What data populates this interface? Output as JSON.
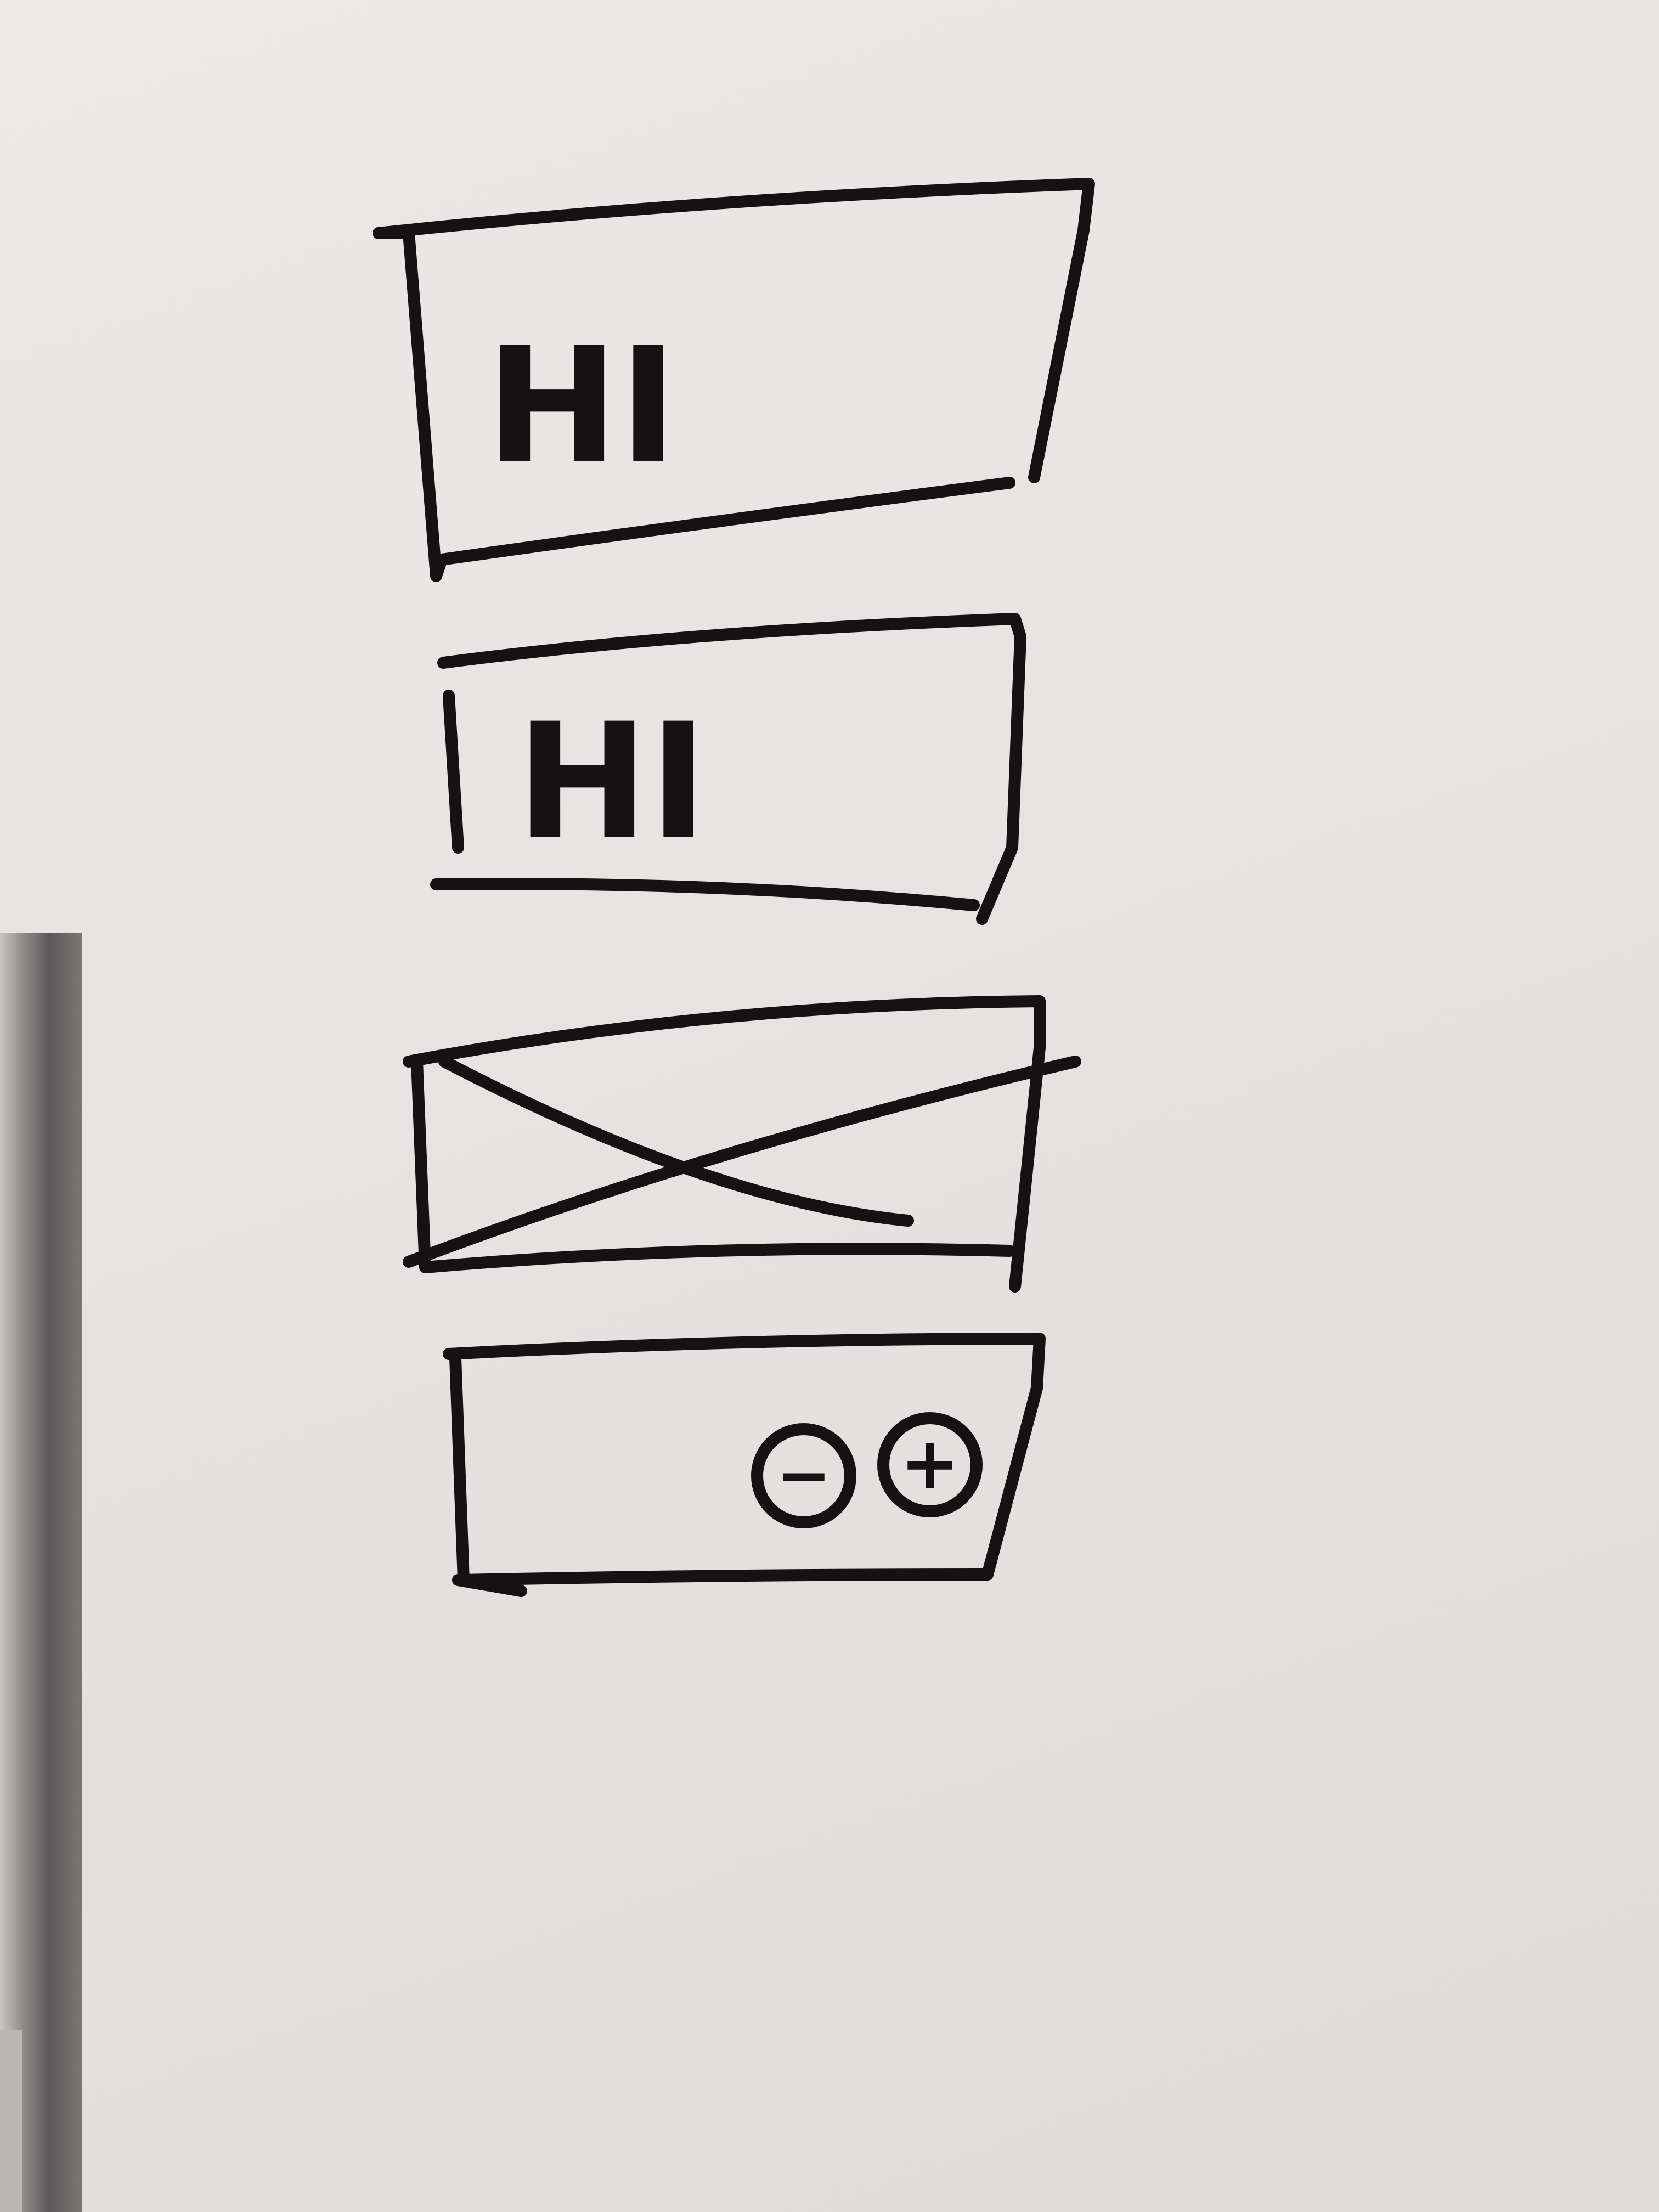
{
  "wireframe": {
    "large_text_box": {
      "text": "HI"
    },
    "text_input": {
      "text": "HI"
    },
    "image_placeholder": {},
    "zoom_card": {
      "zoom_out_symbol": "−",
      "zoom_in_symbol": "+"
    }
  },
  "colors": {
    "marker": "#141212",
    "board": "#e8e5e4"
  }
}
